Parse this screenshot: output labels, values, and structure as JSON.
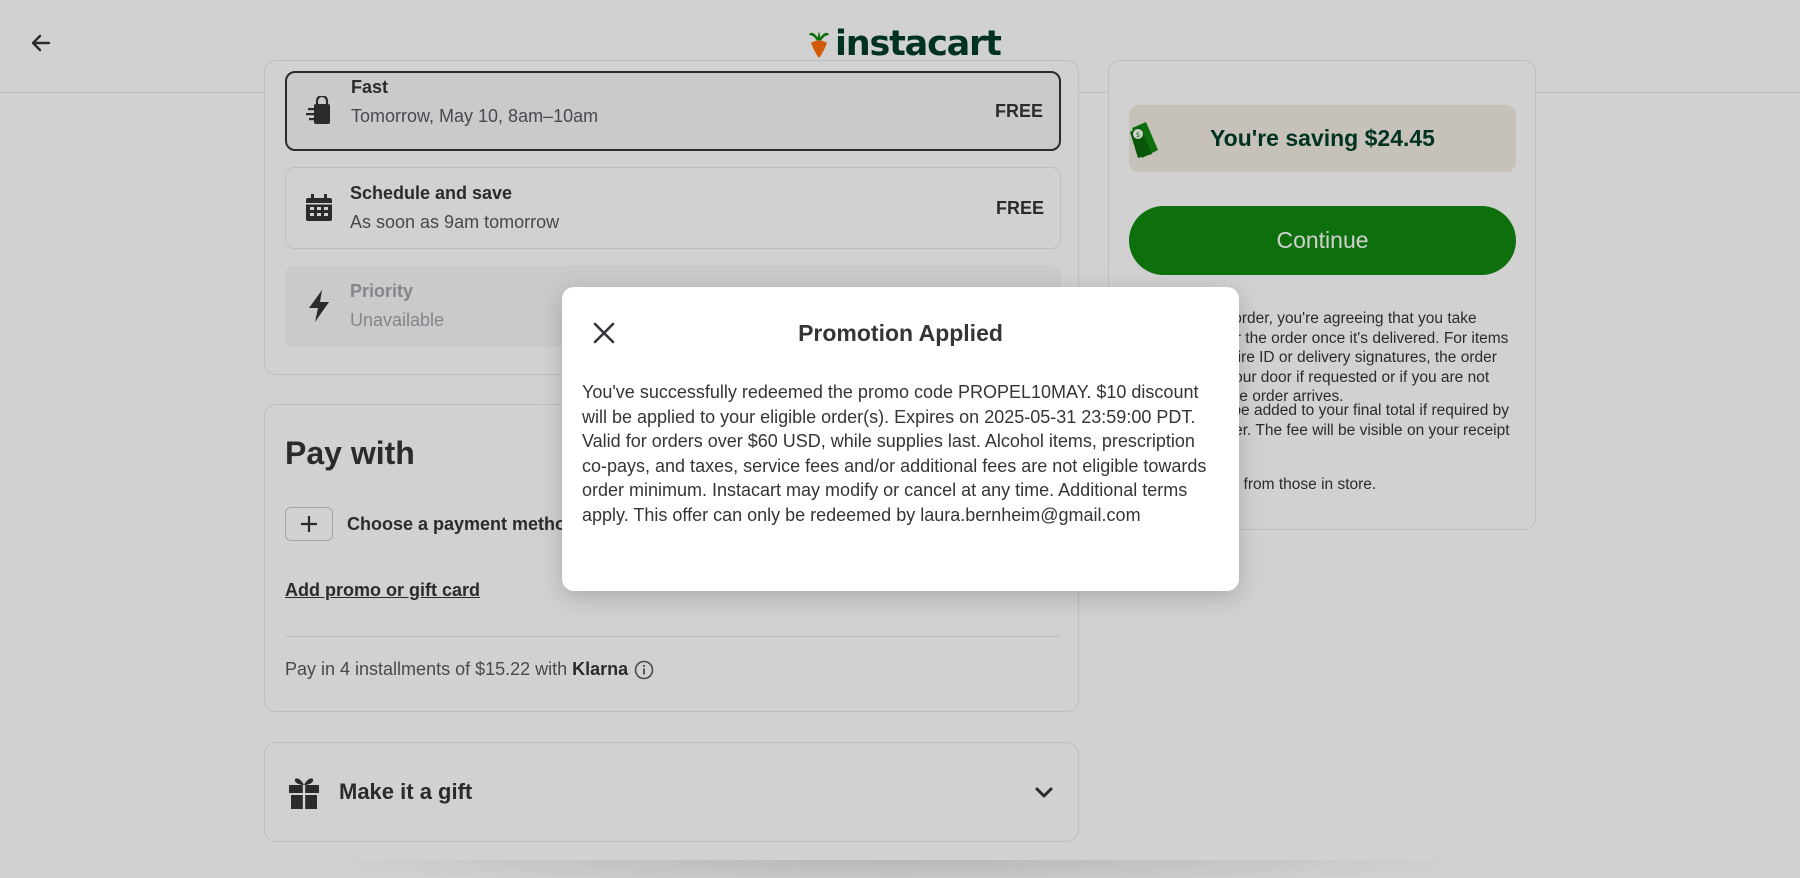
{
  "header": {
    "logo_text": "instacart",
    "logo_colors": {
      "leaf": "#108910",
      "carrot": "#ff7009",
      "text": "#003d29"
    }
  },
  "delivery": {
    "options": [
      {
        "title": "Fast",
        "subtitle": "Tomorrow, May 10, 8am–10am",
        "price": "FREE",
        "icon": "bag-icon",
        "selected": true
      },
      {
        "title": "Schedule and save",
        "subtitle": "As soon as 9am tomorrow",
        "price": "FREE",
        "icon": "calendar-icon",
        "selected": false
      },
      {
        "title": "Priority",
        "subtitle": "Unavailable",
        "price": "",
        "icon": "lightning-icon",
        "disabled": true
      }
    ]
  },
  "payment": {
    "title": "Pay with",
    "choose_label": "Choose a payment method",
    "promo_link": "Add promo or gift card",
    "installments_text": "Pay in 4 installments of $15.22 with",
    "installments_brand": "Klarna"
  },
  "gift": {
    "label": "Make it a gift"
  },
  "summary": {
    "saving_text": "You're saving $24.45",
    "continue_label": "Continue",
    "fine_print": [
      "By placing this order, you're agreeing that you take responsibility for the order once it's delivered. For items that do not require ID or delivery signatures, the order may be left at your door if requested or if you are not present when the order arrives.",
      "A bag fee may be added to your final total if required by law or the retailer. The fee will be visible on your receipt after delivery.",
      "Prices may vary from those in store."
    ]
  },
  "modal": {
    "title": "Promotion Applied",
    "body": "You've successfully redeemed the promo code PROPEL10MAY. $10 discount will be applied to your eligible order(s). Expires on 2025-05-31 23:59:00 PDT. Valid for orders over $60 USD, while supplies last. Alcohol items, prescription co-pays, and taxes, service fees and/or additional fees are not eligible towards order minimum. Instacart may modify or cancel at any time. Additional terms apply. This offer can only be redeemed by laura.bernheim@gmail.com"
  },
  "colors": {
    "accent_green": "#108910",
    "saving_bg": "#f3ede2",
    "text_dark": "#343538"
  }
}
